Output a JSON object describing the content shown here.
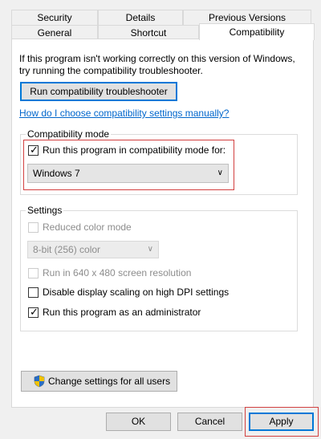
{
  "tabs_row1": [
    "Security",
    "Details",
    "Previous Versions"
  ],
  "tabs_row2": [
    "General",
    "Shortcut",
    "Compatibility"
  ],
  "active_tab": "Compatibility",
  "intro_text": "If this program isn't working correctly on this version of Windows, try running the compatibility troubleshooter.",
  "troubleshooter_button": "Run compatibility troubleshooter",
  "help_link": "How do I choose compatibility settings manually?",
  "compat_mode": {
    "group_label": "Compatibility mode",
    "checkbox_label": "Run this program in compatibility mode for:",
    "checked": true,
    "selected_os": "Windows 7"
  },
  "settings": {
    "group_label": "Settings",
    "reduced_color_label": "Reduced color mode",
    "reduced_color_checked": false,
    "reduced_color_disabled": true,
    "color_depth_value": "8-bit (256) color",
    "resolution_label": "Run in 640 x 480 screen resolution",
    "resolution_checked": false,
    "resolution_disabled": true,
    "dpi_label": "Disable display scaling on high DPI settings",
    "dpi_checked": false,
    "admin_label": "Run this program as an administrator",
    "admin_checked": true
  },
  "change_all_button": "Change settings for all users",
  "footer": {
    "ok": "OK",
    "cancel": "Cancel",
    "apply": "Apply"
  },
  "colors": {
    "link": "#0066cc",
    "highlight_box": "#d24040",
    "focus_border": "#0078d7"
  },
  "icons": {
    "change_all": "uac-shield-icon",
    "dropdown": "chevron-down-icon",
    "check": "checkmark-icon"
  }
}
